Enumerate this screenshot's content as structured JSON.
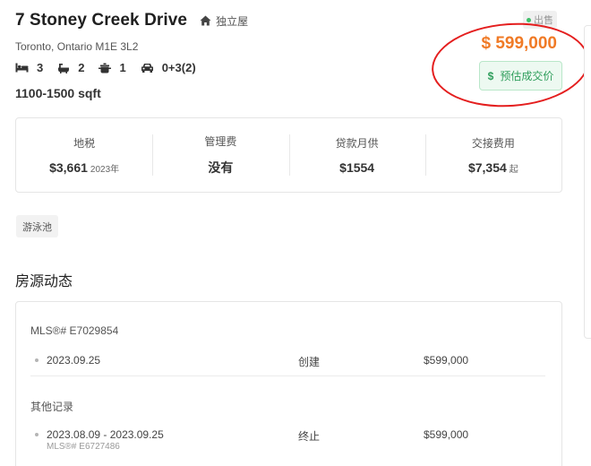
{
  "listing": {
    "title": "7 Stoney Creek Drive",
    "type_label": "独立屋",
    "status": "出售",
    "address": "Toronto, Ontario M1E 3L2",
    "beds": "3",
    "baths": "2",
    "kitchens": "1",
    "parking": "0+3(2)",
    "sqft": "1100-1500 sqft",
    "price": "$ 599,000",
    "estimate_label": "预估成交价",
    "estimate_icon": "$"
  },
  "stats": [
    {
      "label": "地税",
      "value": "$3,661",
      "sub": "2023年"
    },
    {
      "label": "管理费",
      "value": "没有",
      "sub": ""
    },
    {
      "label": "贷款月供",
      "value": "$1554",
      "sub": ""
    },
    {
      "label": "交接费用",
      "value": "$7,354",
      "sub": "起"
    }
  ],
  "tags": [
    "游泳池"
  ],
  "history": {
    "title": "房源动态",
    "current_mls": "MLS®# E7029854",
    "current": {
      "date": "2023.09.25",
      "status": "创建",
      "price": "$599,000"
    },
    "other_label": "其他记录",
    "other": {
      "date": "2023.08.09 - 2023.09.25",
      "mls": "MLS®# E6727486",
      "status": "终止",
      "price": "$599,000"
    }
  },
  "colors": {
    "price": "#f07a26",
    "estimate_green": "#2f9e5c",
    "annotation": "#e41e1e"
  }
}
